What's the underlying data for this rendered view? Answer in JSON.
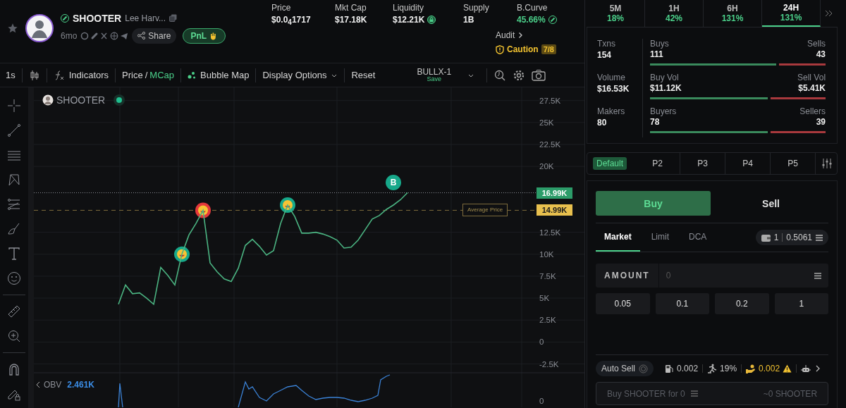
{
  "header": {
    "token": {
      "symbol": "SHOOTER",
      "name": "Lee Harv...",
      "age": "6mo"
    },
    "share_label": "Share",
    "pnl_label": "PnL",
    "stats": [
      {
        "label": "Price",
        "value": "$0.0$_{4}$1717",
        "kind": "plain"
      },
      {
        "label": "Mkt Cap",
        "value": "$17.18K",
        "kind": "plain"
      },
      {
        "label": "Liquidity",
        "value": "$12.21K",
        "kind": "locked"
      },
      {
        "label": "Supply",
        "value": "1B",
        "kind": "plain"
      },
      {
        "label": "B.Curve",
        "value": "45.66%",
        "kind": "curve"
      }
    ],
    "audit": {
      "label": "Audit",
      "status": "Caution",
      "score": "7/8"
    }
  },
  "toolbar": {
    "interval": "1s",
    "indicators": "Indicators",
    "scale_options": [
      {
        "label": "Price",
        "selected": false
      },
      {
        "label": "MCap",
        "selected": true
      }
    ],
    "scale_separator": "/",
    "bubble_map": "Bubble Map",
    "display_options": "Display Options",
    "reset": "Reset",
    "layout": {
      "name": "BULLX-1",
      "action": "Save"
    }
  },
  "chart": {
    "live": true,
    "last_price": "16.99K",
    "average_price": {
      "label": "Average Price",
      "value": "14.99K"
    },
    "obv": {
      "label": "OBV",
      "value": "2.461K",
      "axis": "0"
    },
    "markers": [
      {
        "kind": "emoji",
        "color": "#17a88a"
      },
      {
        "kind": "emoji",
        "color": "#e5383b"
      },
      {
        "kind": "emoji",
        "color": "#17a88a"
      },
      {
        "kind": "letter",
        "label": "B",
        "color": "#17a88a"
      }
    ],
    "chart_data": {
      "type": "line",
      "ylim": [
        -3500,
        29000
      ],
      "grid": true,
      "yticks": [
        {
          "value": 27500,
          "label": "27.5K"
        },
        {
          "value": 25000,
          "label": "25K"
        },
        {
          "value": 22500,
          "label": "22.5K"
        },
        {
          "value": 20000,
          "label": "20K"
        },
        {
          "value": 12500,
          "label": "12.5K"
        },
        {
          "value": 10000,
          "label": "10K"
        },
        {
          "value": 7500,
          "label": "7.5K"
        },
        {
          "value": 5000,
          "label": "5K"
        },
        {
          "value": 2500,
          "label": "2.5K"
        },
        {
          "value": 0,
          "label": "0"
        },
        {
          "value": -2500,
          "label": "-2.5K"
        }
      ],
      "ref_lines": [
        {
          "axis": "y",
          "value": 17000
        },
        {
          "axis": "y",
          "value": 15000
        }
      ],
      "series": [
        {
          "name": "SHOOTER",
          "color": "#4bb482",
          "values": [
            4300,
            6500,
            5500,
            5600,
            5000,
            4300,
            8500,
            7600,
            6500,
            10000,
            12200,
            13500,
            15000,
            9000,
            8000,
            7200,
            6900,
            8400,
            11000,
            11700,
            10900,
            9900,
            10400,
            13500,
            15600,
            14300,
            12400,
            12400,
            12500,
            12300,
            12000,
            11600,
            10700,
            10800,
            11600,
            12800,
            14000,
            14400,
            15100,
            15600,
            16200,
            17000
          ]
        }
      ]
    }
  },
  "timeframes": [
    {
      "label": "5M",
      "change": "18%",
      "selected": false
    },
    {
      "label": "1H",
      "change": "42%",
      "selected": false
    },
    {
      "label": "6H",
      "change": "131%",
      "selected": false
    },
    {
      "label": "24H",
      "change": "131%",
      "selected": true
    }
  ],
  "stats": {
    "left": [
      {
        "label": "Txns",
        "value": "154"
      },
      {
        "label": "Volume",
        "value": "$16.53K"
      },
      {
        "label": "Makers",
        "value": "80"
      }
    ],
    "splits": [
      {
        "buy_label": "Buys",
        "buy_value": "111",
        "sell_label": "Sells",
        "sell_value": "43",
        "level": 0.72
      },
      {
        "buy_label": "Buy Vol",
        "buy_value": "$11.12K",
        "sell_label": "Sell Vol",
        "sell_value": "$5.41K",
        "level": 0.67
      },
      {
        "buy_label": "Buyers",
        "buy_value": "78",
        "sell_label": "Sellers",
        "sell_value": "39",
        "level": 0.67
      }
    ]
  },
  "presets": [
    {
      "label": "Default",
      "selected": true
    },
    {
      "label": "P2",
      "selected": false
    },
    {
      "label": "P3",
      "selected": false
    },
    {
      "label": "P4",
      "selected": false
    },
    {
      "label": "P5",
      "selected": false
    }
  ],
  "trade": {
    "sides": [
      {
        "label": "Buy",
        "selected": true
      },
      {
        "label": "Sell",
        "selected": false
      }
    ],
    "order_types": [
      {
        "label": "Market",
        "selected": true
      },
      {
        "label": "Limit",
        "selected": false
      },
      {
        "label": "DCA",
        "selected": false
      }
    ],
    "wallet": {
      "count": "1",
      "balance": "0.5061"
    },
    "amount": {
      "label": "AMOUNT",
      "placeholder": "0"
    },
    "quick_amounts": [
      "0.05",
      "0.1",
      "0.2",
      "1"
    ],
    "auto_sell": {
      "label": "Auto Sell",
      "on": false
    },
    "settings": [
      {
        "kind": "gas",
        "value": "0.002",
        "warning": false
      },
      {
        "kind": "slippage",
        "value": "19%",
        "warning": false
      },
      {
        "kind": "tip",
        "value": "0.002",
        "warning": true
      }
    ],
    "submit": {
      "label": "Buy SHOOTER for 0",
      "estimate": "~0 SHOOTER"
    }
  }
}
